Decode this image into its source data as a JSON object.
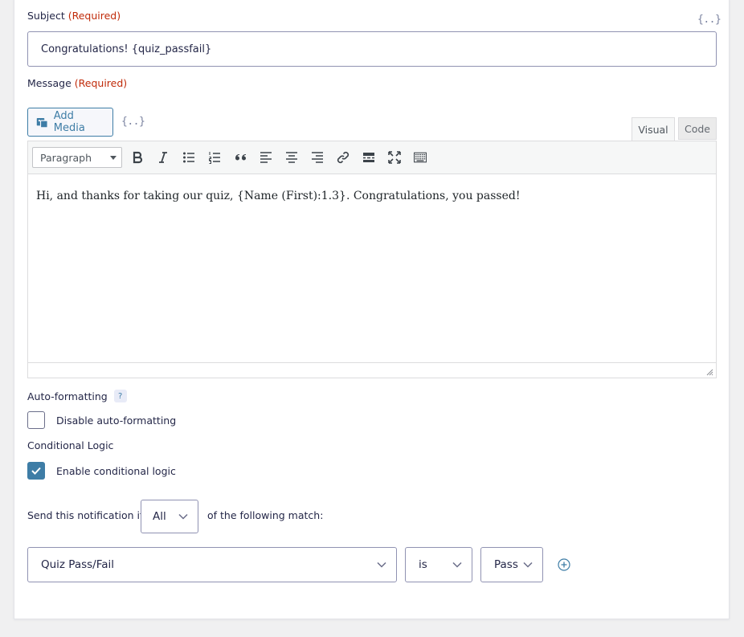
{
  "subject": {
    "label": "Subject",
    "required": "(Required)",
    "merge_tag": "{..}",
    "value": "Congratulations! {quiz_passfail}"
  },
  "message": {
    "label": "Message",
    "required": "(Required)",
    "add_media": "Add Media",
    "merge_tag": "{..}",
    "tabs": {
      "visual": "Visual",
      "code": "Code"
    },
    "format_select": "Paragraph",
    "toolbar_icons": [
      "bold-icon",
      "italic-icon",
      "bullet-list-icon",
      "numbered-list-icon",
      "blockquote-icon",
      "align-left-icon",
      "align-center-icon",
      "align-right-icon",
      "link-icon",
      "read-more-icon",
      "fullscreen-icon",
      "toolbar-toggle-icon"
    ],
    "body": "Hi, and thanks for taking our quiz, {Name (First):1.3}. Congratulations, you passed!"
  },
  "auto_formatting": {
    "label": "Auto-formatting",
    "help": "?",
    "checkbox_label": "Disable auto-formatting",
    "checked": false
  },
  "conditional_logic": {
    "label": "Conditional Logic",
    "checkbox_label": "Enable conditional logic",
    "checked": true,
    "sentence_prefix": "Send this notification if",
    "match_type": "All",
    "sentence_suffix": "of the following match:",
    "rule": {
      "field": "Quiz Pass/Fail",
      "operator": "is",
      "value": "Pass"
    }
  },
  "colors": {
    "accent": "#3e7da6",
    "required": "#c02b0a"
  }
}
